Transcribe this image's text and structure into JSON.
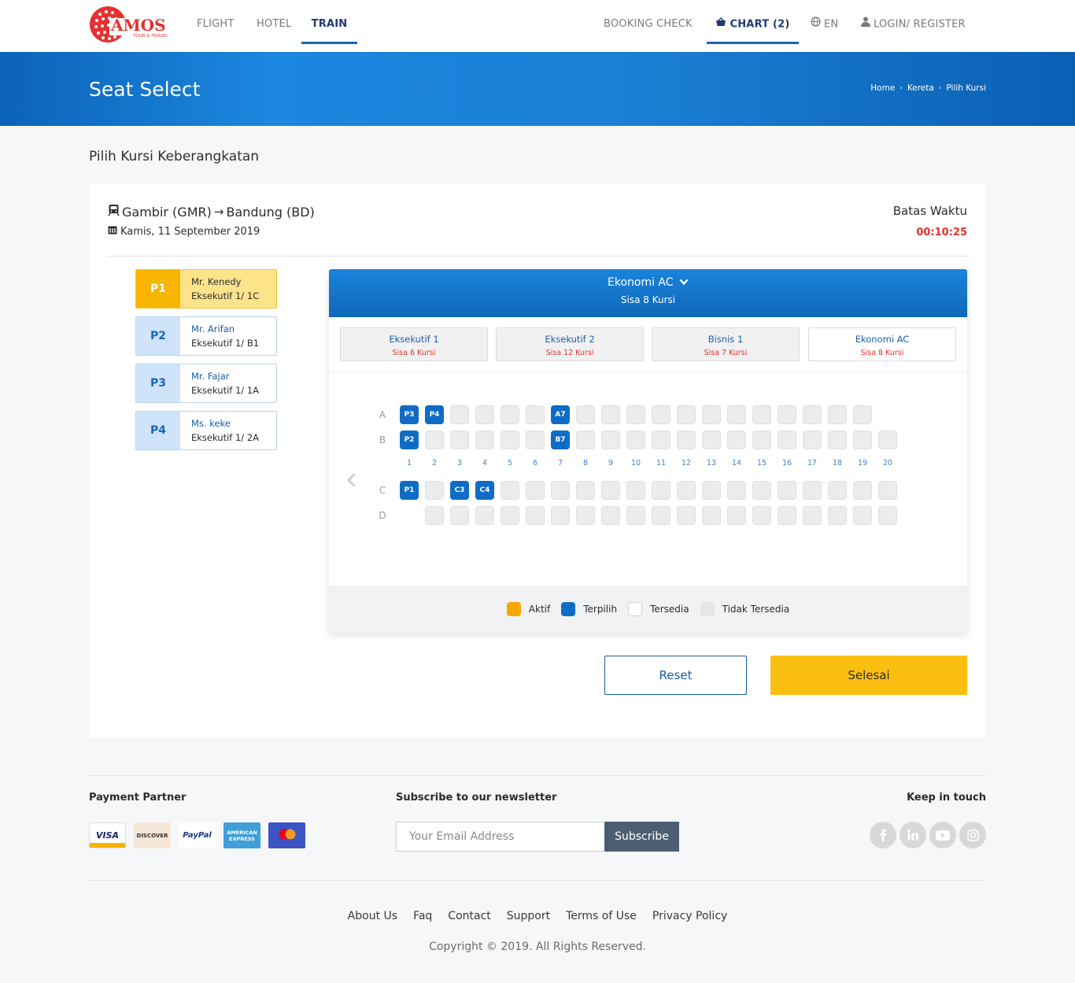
{
  "brand": {
    "name": "AMOS",
    "tagline": "TOUR & TRAVEL",
    "color": "#e53131"
  },
  "nav": {
    "flight": "FLIGHT",
    "hotel": "HOTEL",
    "train": "TRAIN",
    "booking_check": "BOOKING CHECK",
    "chart": "CHART (2)",
    "lang": "EN",
    "login": "LOGIN/ REGISTER"
  },
  "banner": {
    "title": "Seat Select",
    "breadcrumb": [
      "Home",
      "Kereta",
      "Pilih Kursi"
    ]
  },
  "section_title": "Pilih Kursi Keberangkatan",
  "trip": {
    "route_from": "Gambir (GMR)",
    "route_to": "Bandung (BD)",
    "date": "Kamis, 11 September 2019",
    "deadline_label": "Batas Waktu",
    "deadline_time": "00:10:25"
  },
  "passengers": [
    {
      "id": "P1",
      "name": "Mr. Kenedy",
      "seat": "Eksekutif 1/ 1C",
      "active": true
    },
    {
      "id": "P2",
      "name": "Mr. Arifan",
      "seat": "Eksekutif 1/ B1",
      "active": false
    },
    {
      "id": "P3",
      "name": "Mr. Fajar",
      "seat": "Eksekutif 1/ 1A",
      "active": false
    },
    {
      "id": "P4",
      "name": "Ms. keke",
      "seat": "Eksekutif 1/ 2A",
      "active": false
    }
  ],
  "coach": {
    "current": "Ekonomi AC",
    "remaining": "Sisa 8 Kursi",
    "tabs": [
      {
        "name": "Eksekutif 1",
        "remaining": "Sisa 6 Kursi"
      },
      {
        "name": "Eksekutif 2",
        "remaining": "Sisa 12 Kursi"
      },
      {
        "name": "Bisnis 1",
        "remaining": "Sisa 7 Kursi"
      },
      {
        "name": "Ekonomi AC",
        "remaining": "Sisa 8 Kursi"
      }
    ]
  },
  "seatmap": {
    "rows": [
      "A",
      "B",
      "C",
      "D"
    ],
    "columns": [
      "1",
      "2",
      "3",
      "4",
      "5",
      "6",
      "7",
      "8",
      "9",
      "10",
      "11",
      "12",
      "13",
      "14",
      "15",
      "16",
      "17",
      "18",
      "19",
      "20"
    ],
    "selected": [
      {
        "row": "A",
        "col": 1,
        "label": "P3"
      },
      {
        "row": "A",
        "col": 2,
        "label": "P4"
      },
      {
        "row": "A",
        "col": 7,
        "label": "A7"
      },
      {
        "row": "B",
        "col": 1,
        "label": "P2"
      },
      {
        "row": "B",
        "col": 7,
        "label": "B7"
      },
      {
        "row": "C",
        "col": 1,
        "label": "P1"
      },
      {
        "row": "C",
        "col": 3,
        "label": "C3"
      },
      {
        "row": "C",
        "col": 4,
        "label": "C4"
      }
    ]
  },
  "legend": {
    "aktif": "Aktif",
    "terpilih": "Terpilih",
    "tersedia": "Tersedia",
    "tidak_tersedia": "Tidak Tersedia",
    "colors": {
      "aktif": "#f7a800",
      "terpilih": "#0f6cc6",
      "tersedia": "#ffffff",
      "tidak_tersedia": "#e6e6e6"
    }
  },
  "buttons": {
    "reset": "Reset",
    "done": "Selesai"
  },
  "footer": {
    "payment_title": "Payment Partner",
    "payments": [
      "VISA",
      "DISCOVER",
      "PayPal",
      "AMERICAN EXPRESS",
      "mastercard-icon"
    ],
    "newsletter_title": "Subscribe to our newsletter",
    "email_placeholder": "Your Email Address",
    "subscribe": "Subscribe",
    "touch_title": "Keep in touch",
    "social": [
      "facebook-icon",
      "linkedin-icon",
      "youtube-icon",
      "instagram-icon"
    ],
    "links": [
      "About Us",
      "Faq",
      "Contact",
      "Support",
      "Terms of Use",
      "Privacy Policy"
    ],
    "copyright": "Copyright © 2019. All Rights Reserved."
  }
}
